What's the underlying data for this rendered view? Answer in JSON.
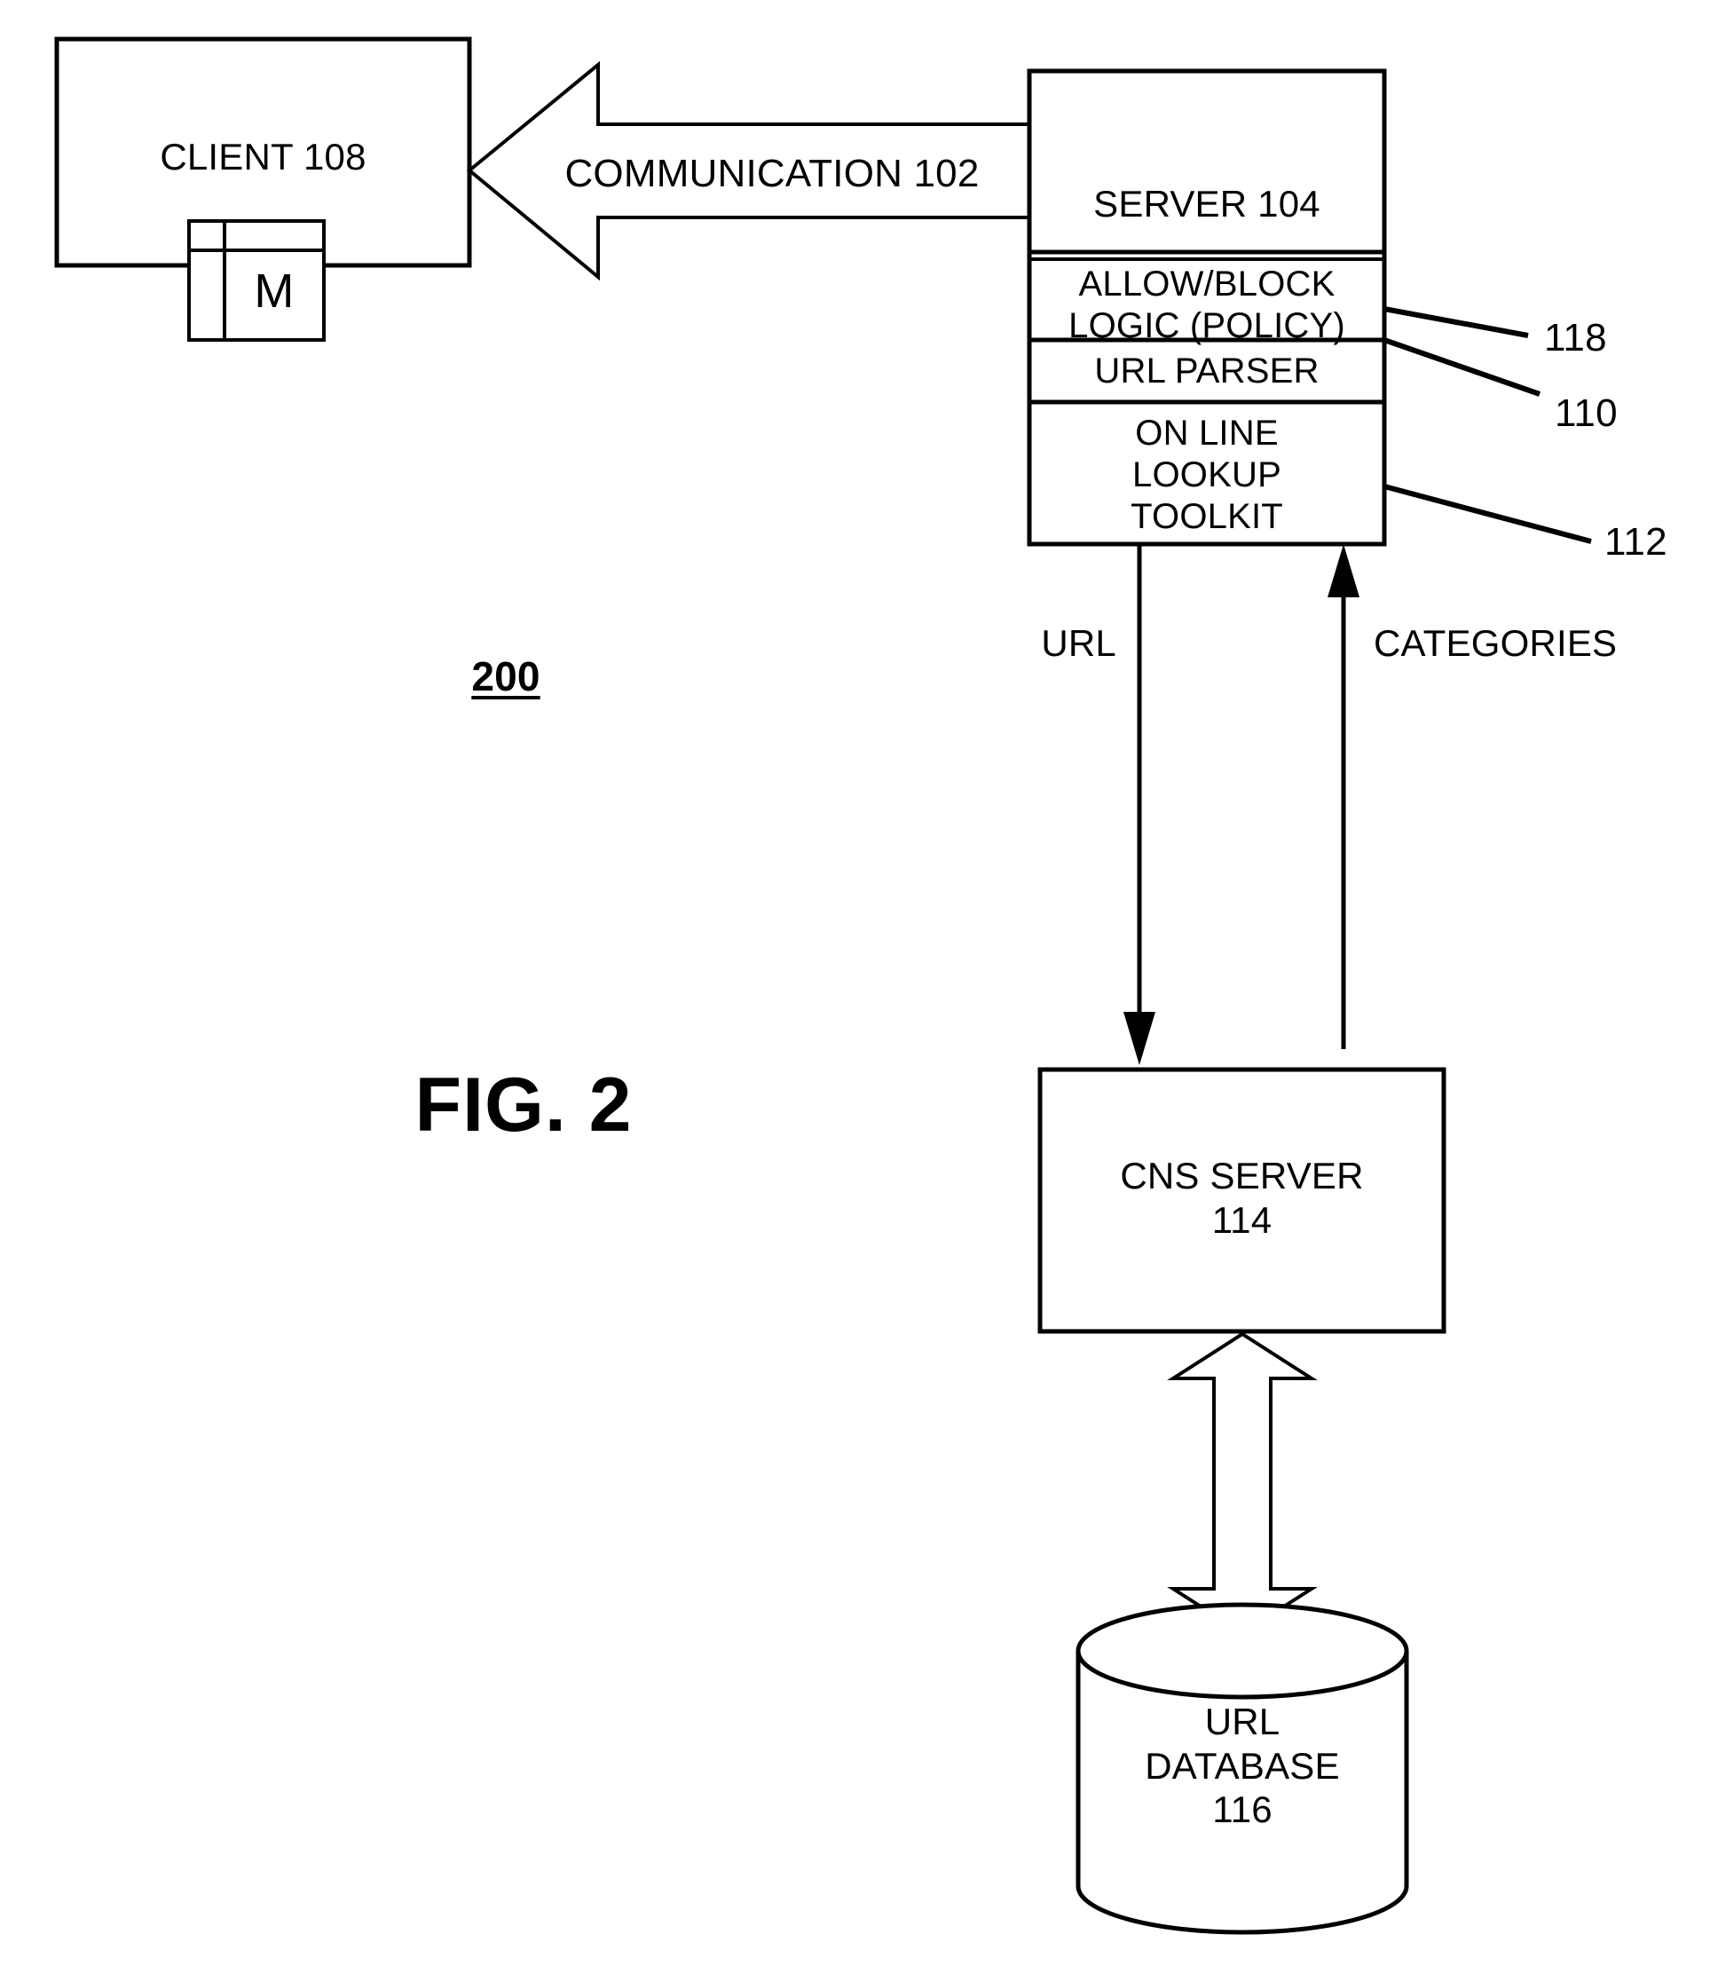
{
  "figure": {
    "title": "FIG. 2",
    "number_label": "200"
  },
  "nodes": {
    "client": {
      "label": "CLIENT 108",
      "icon_letter": "M",
      "icon_name": "browser-window-icon"
    },
    "server": {
      "label": "SERVER 104",
      "modules": [
        {
          "label": "ALLOW/BLOCK\nLOGIC (POLICY)",
          "ref": "118"
        },
        {
          "label": "URL PARSER",
          "ref": "110"
        },
        {
          "label": "ON LINE\nLOOKUP\nTOOLKIT",
          "ref": "112"
        }
      ]
    },
    "cns_server": {
      "label": "CNS SERVER\n114"
    },
    "url_database": {
      "label": "URL\nDATABASE\n116"
    }
  },
  "connectors": {
    "communication": {
      "label": "COMMUNICATION 102",
      "style": "hollow-block-arrow",
      "direction": "server-to-client"
    },
    "url_flow": {
      "label": "URL",
      "style": "solid-arrow",
      "direction": "toolkit-to-cns"
    },
    "categories_flow": {
      "label": "CATEGORIES",
      "style": "solid-arrow",
      "direction": "cns-to-toolkit"
    },
    "db_link": {
      "label": "",
      "style": "hollow-double-arrow",
      "direction": "bidirectional"
    }
  },
  "reference_numerals": {
    "r118": "118",
    "r110": "110",
    "r112": "112"
  },
  "colors": {
    "ink": "#000000",
    "paper": "#ffffff"
  }
}
